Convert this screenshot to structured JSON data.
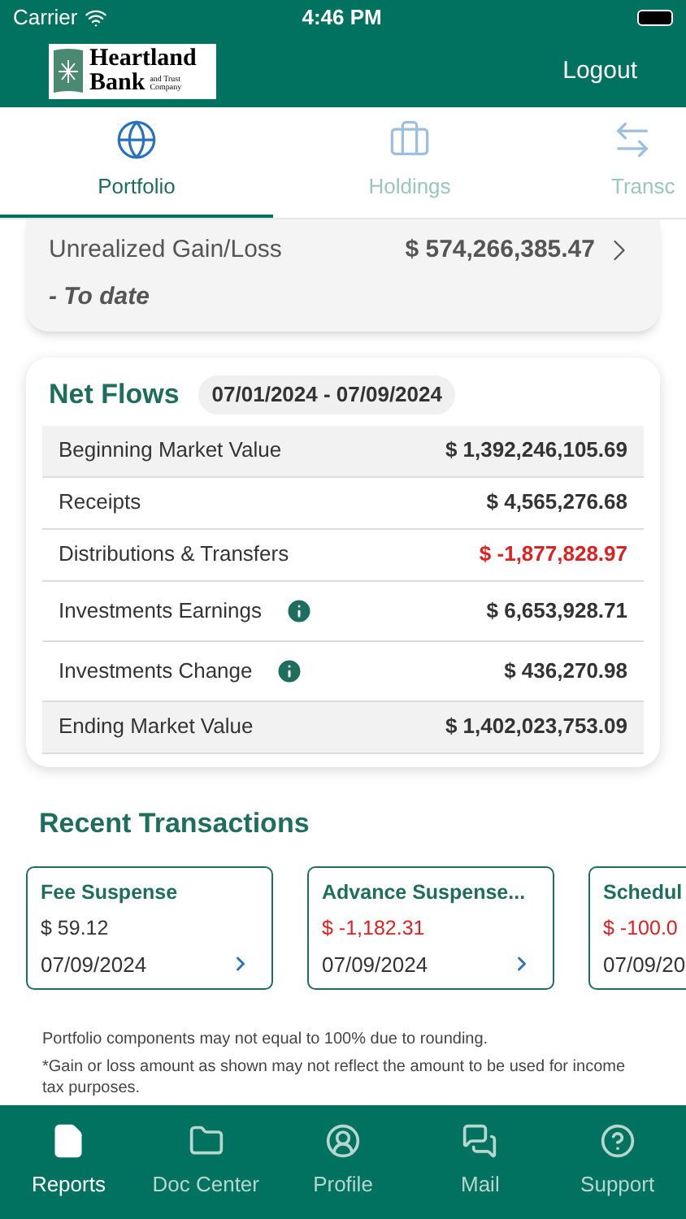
{
  "status_bar": {
    "carrier": "Carrier",
    "time": "4:46 PM"
  },
  "header": {
    "logo": {
      "line_1": "Heartland",
      "line_2": "Bank",
      "line_3": "and Trust",
      "line_4": "Company"
    },
    "logout": "Logout"
  },
  "tabs": [
    {
      "label": "Portfolio",
      "selected": true,
      "kind": "globe"
    },
    {
      "label": "Holdings",
      "selected": false,
      "kind": "briefcase"
    },
    {
      "label": "Transc",
      "selected": false,
      "kind": "arrows"
    }
  ],
  "unrealized": {
    "label": "Unrealized Gain/Loss",
    "sublabel": "- To date",
    "value": "$ 574,266,385.47"
  },
  "net_flows": {
    "title": "Net Flows",
    "period": "07/01/2024 - 07/09/2024",
    "rows": [
      {
        "label": "Beginning Market Value",
        "value": "$ 1,392,246,105.69",
        "highlighted": true,
        "negative": false,
        "info": false
      },
      {
        "label": "Receipts",
        "value": "$ 4,565,276.68",
        "highlighted": false,
        "negative": false,
        "info": false
      },
      {
        "label": "Distributions & Transfers",
        "value": "$ -1,877,828.97",
        "highlighted": false,
        "negative": true,
        "info": false
      },
      {
        "label": "Investments Earnings",
        "value": "$ 6,653,928.71",
        "highlighted": false,
        "negative": false,
        "info": true
      },
      {
        "label": "Investments Change",
        "value": "$ 436,270.98",
        "highlighted": false,
        "negative": false,
        "info": true
      },
      {
        "label": "Ending Market Value",
        "value": "$ 1,402,023,753.09",
        "highlighted": true,
        "negative": false,
        "info": false
      }
    ]
  },
  "recent_transactions": {
    "title": "Recent Transactions",
    "cards": [
      {
        "name": "Fee Suspense",
        "amount": "$ 59.12",
        "date": "07/09/2024",
        "negative": false,
        "chevron": true
      },
      {
        "name": "Advance Suspense...",
        "amount": "$ -1,182.31",
        "date": "07/09/2024",
        "negative": true,
        "chevron": true
      },
      {
        "name": "Schedul",
        "amount": "$ -100.0",
        "date": "07/09/20",
        "negative": true,
        "chevron": false
      }
    ]
  },
  "footnotes": [
    "Portfolio components may not equal to 100% due to rounding.",
    "*Gain or loss amount as shown may not reflect the amount to be used for income tax purposes."
  ],
  "bottom_nav": [
    {
      "label": "Reports",
      "selected": true,
      "kind": "file"
    },
    {
      "label": "Doc Center",
      "selected": false,
      "kind": "folder"
    },
    {
      "label": "Profile",
      "selected": false,
      "kind": "user"
    },
    {
      "label": "Mail",
      "selected": false,
      "kind": "chat"
    },
    {
      "label": "Support",
      "selected": false,
      "kind": "help"
    }
  ]
}
